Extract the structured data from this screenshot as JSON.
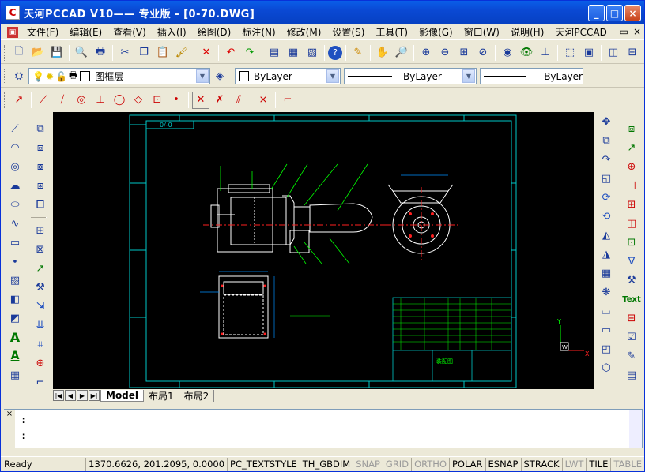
{
  "window": {
    "title": "天河PCCAD V10—— 专业版 - [0-70.DWG]",
    "app_icon": "CAD"
  },
  "menu": [
    "文件(F)",
    "编辑(E)",
    "查看(V)",
    "插入(I)",
    "绘图(D)",
    "标注(N)",
    "修改(M)",
    "设置(S)",
    "工具(T)",
    "影像(G)",
    "窗口(W)",
    "说明(H)",
    "天河PCCAD"
  ],
  "layer": {
    "name": "图框层"
  },
  "props": {
    "color": "ByLayer",
    "linetype": "ByLayer",
    "lineweight": "ByLayer"
  },
  "tabs": [
    "Model",
    "布局1",
    "布局2"
  ],
  "command": {
    "line1": ":",
    "line2": ":"
  },
  "status": {
    "ready": "Ready",
    "coords": "1370.6626, 201.2095, 0.0000",
    "cells": [
      {
        "label": "PC_TEXTSTYLE",
        "on": true
      },
      {
        "label": "TH_GBDIM",
        "on": true
      },
      {
        "label": "SNAP",
        "on": false
      },
      {
        "label": "GRID",
        "on": false
      },
      {
        "label": "ORTHO",
        "on": false
      },
      {
        "label": "POLAR",
        "on": true
      },
      {
        "label": "ESNAP",
        "on": true
      },
      {
        "label": "STRACK",
        "on": true
      },
      {
        "label": "LWT",
        "on": false
      },
      {
        "label": "TILE",
        "on": true
      },
      {
        "label": "TABLE",
        "on": false
      }
    ]
  },
  "drawing": {
    "ucs_y": "Y",
    "ucs_x": "X",
    "ucs_w": "W",
    "drawing_no": "0/-0",
    "title_block": "装配图",
    "text_label": "Text"
  },
  "colors": {
    "frame": "#00c8c8",
    "geometry": "#ffffff",
    "centerline": "#ff2020",
    "annot": "#00ff00",
    "dim": "#0090ff"
  }
}
